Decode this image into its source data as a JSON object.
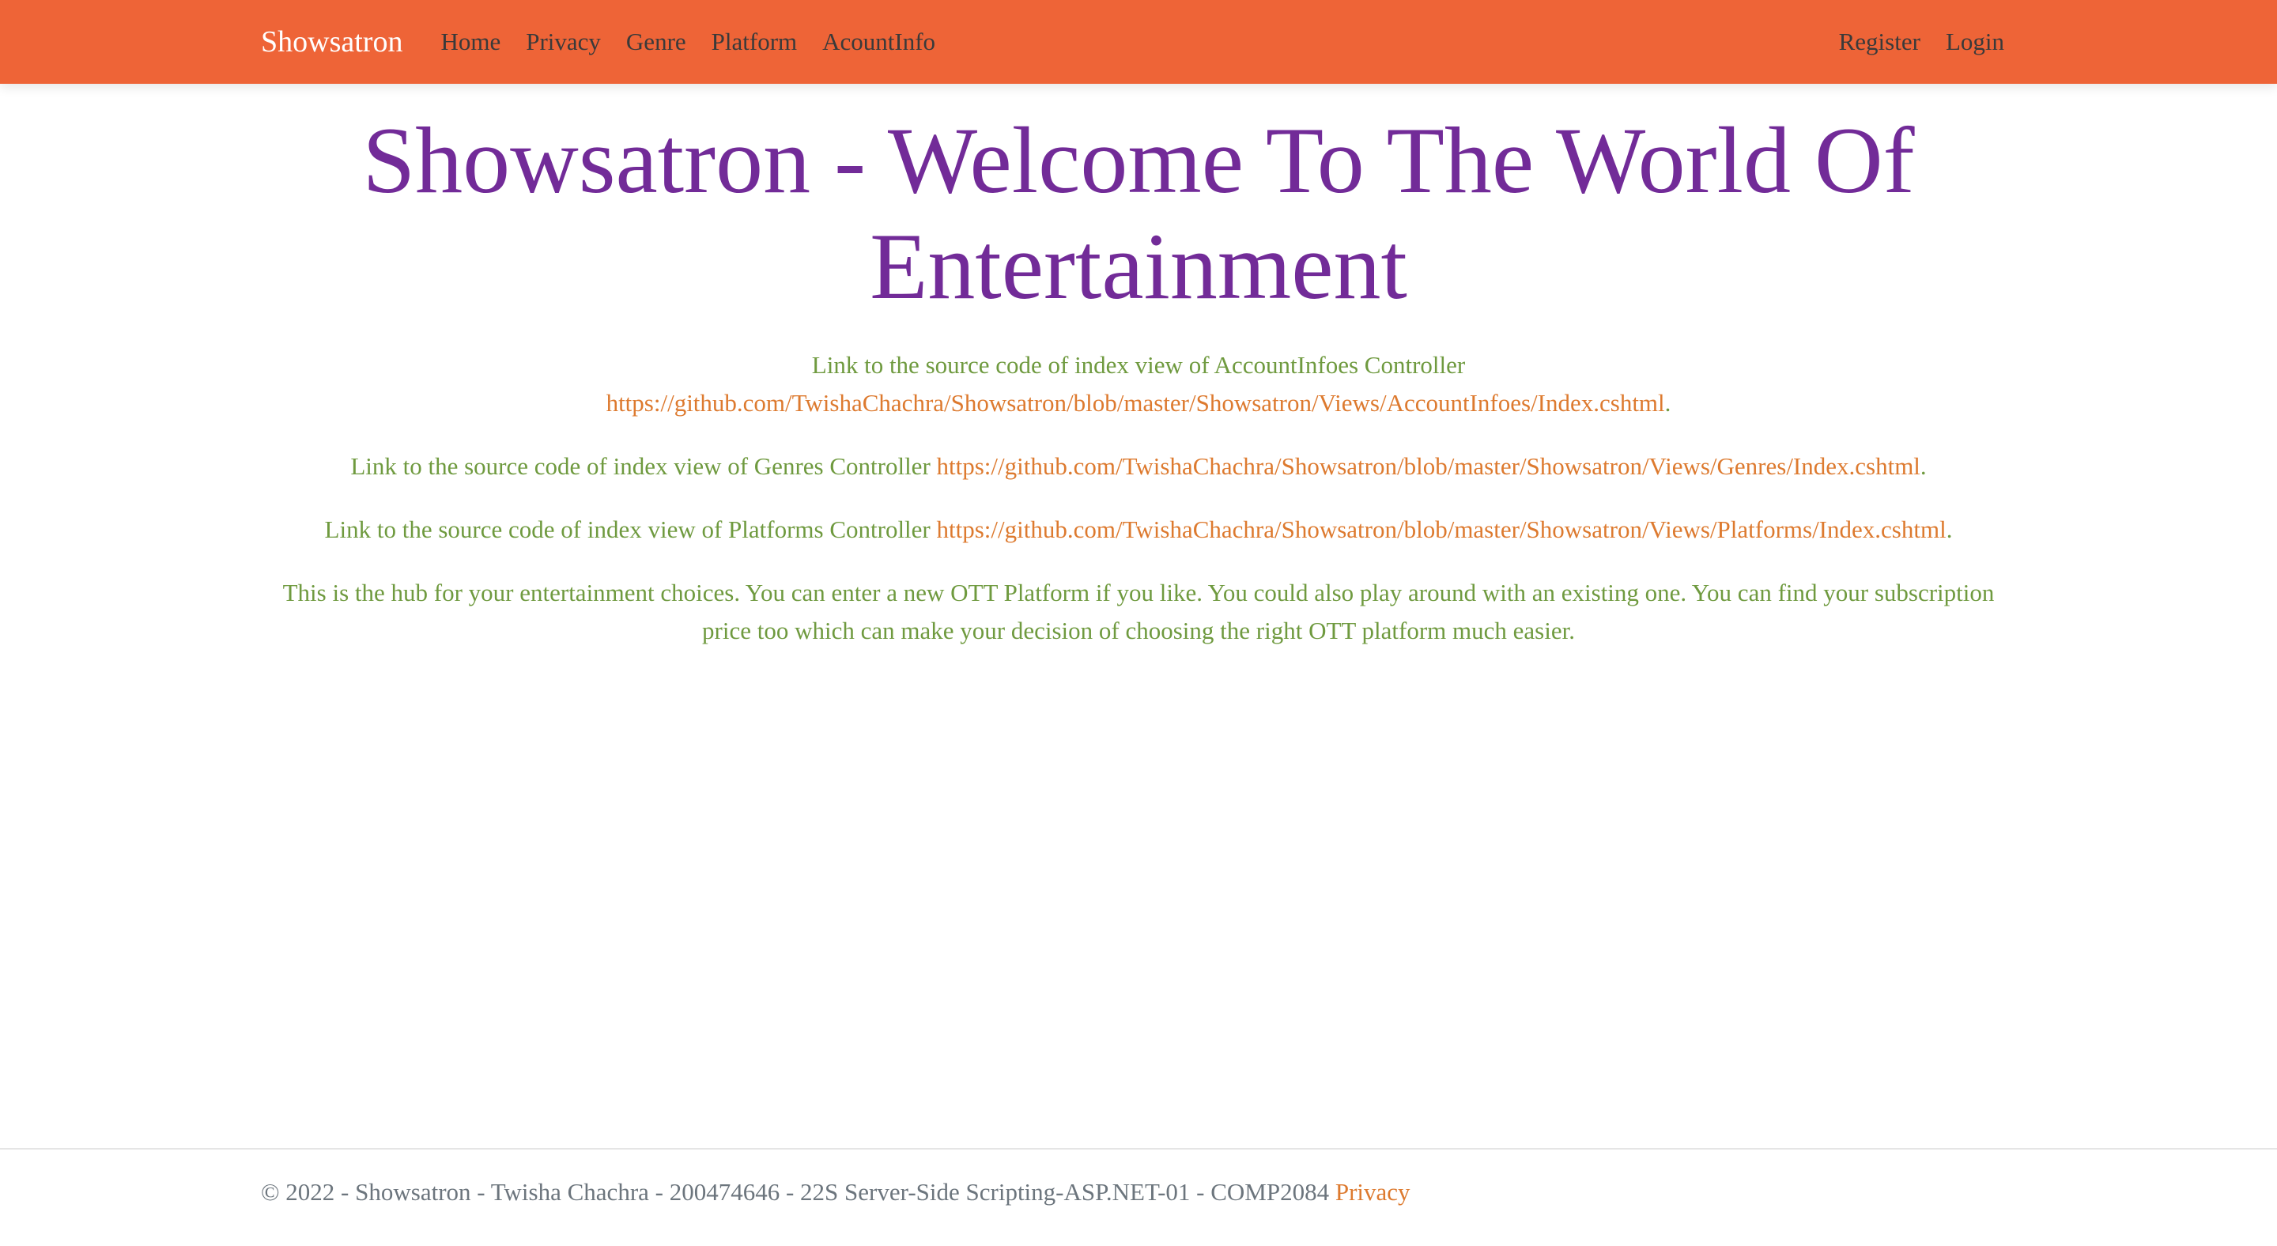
{
  "navbar": {
    "brand": "Showsatron",
    "links": [
      "Home",
      "Privacy",
      "Genre",
      "Platform",
      "AcountInfo"
    ],
    "right_links": [
      "Register",
      "Login"
    ],
    "background_color": "#ee6437"
  },
  "main": {
    "title": "Showsatron - Welcome To The World Of Entertainment",
    "paragraphs": [
      {
        "text": "Link to the source code of index view of AccountInfoes Controller",
        "link": "https://github.com/TwishaChachra/Showsatron/blob/master/Showsatron/Views/AccountInfoes/Index.cshtml"
      },
      {
        "text": "Link to the source code of index view of Genres Controller",
        "link": "https://github.com/TwishaChachra/Showsatron/blob/master/Showsatron/Views/Genres/Index.cshtml"
      },
      {
        "text": "Link to the source code of index view of Platforms Controller",
        "link": "https://github.com/TwishaChachra/Showsatron/blob/master/Showsatron/Views/Platforms/Index.cshtml"
      }
    ],
    "description": "This is the hub for your entertainment choices. You can enter a new OTT Platform if you like. You could also play around with an existing one. You can find your subscription price too which can make your decision of choosing the right OTT platform much easier.",
    "title_color": "#722b98",
    "text_color": "#6f9a3f",
    "link_color": "#dd7a2f"
  },
  "footer": {
    "text": "© 2022 - Showsatron - Twisha Chachra - 200474646 - 22S Server-Side Scripting-ASP.NET-01 - COMP2084",
    "link": "Privacy"
  }
}
